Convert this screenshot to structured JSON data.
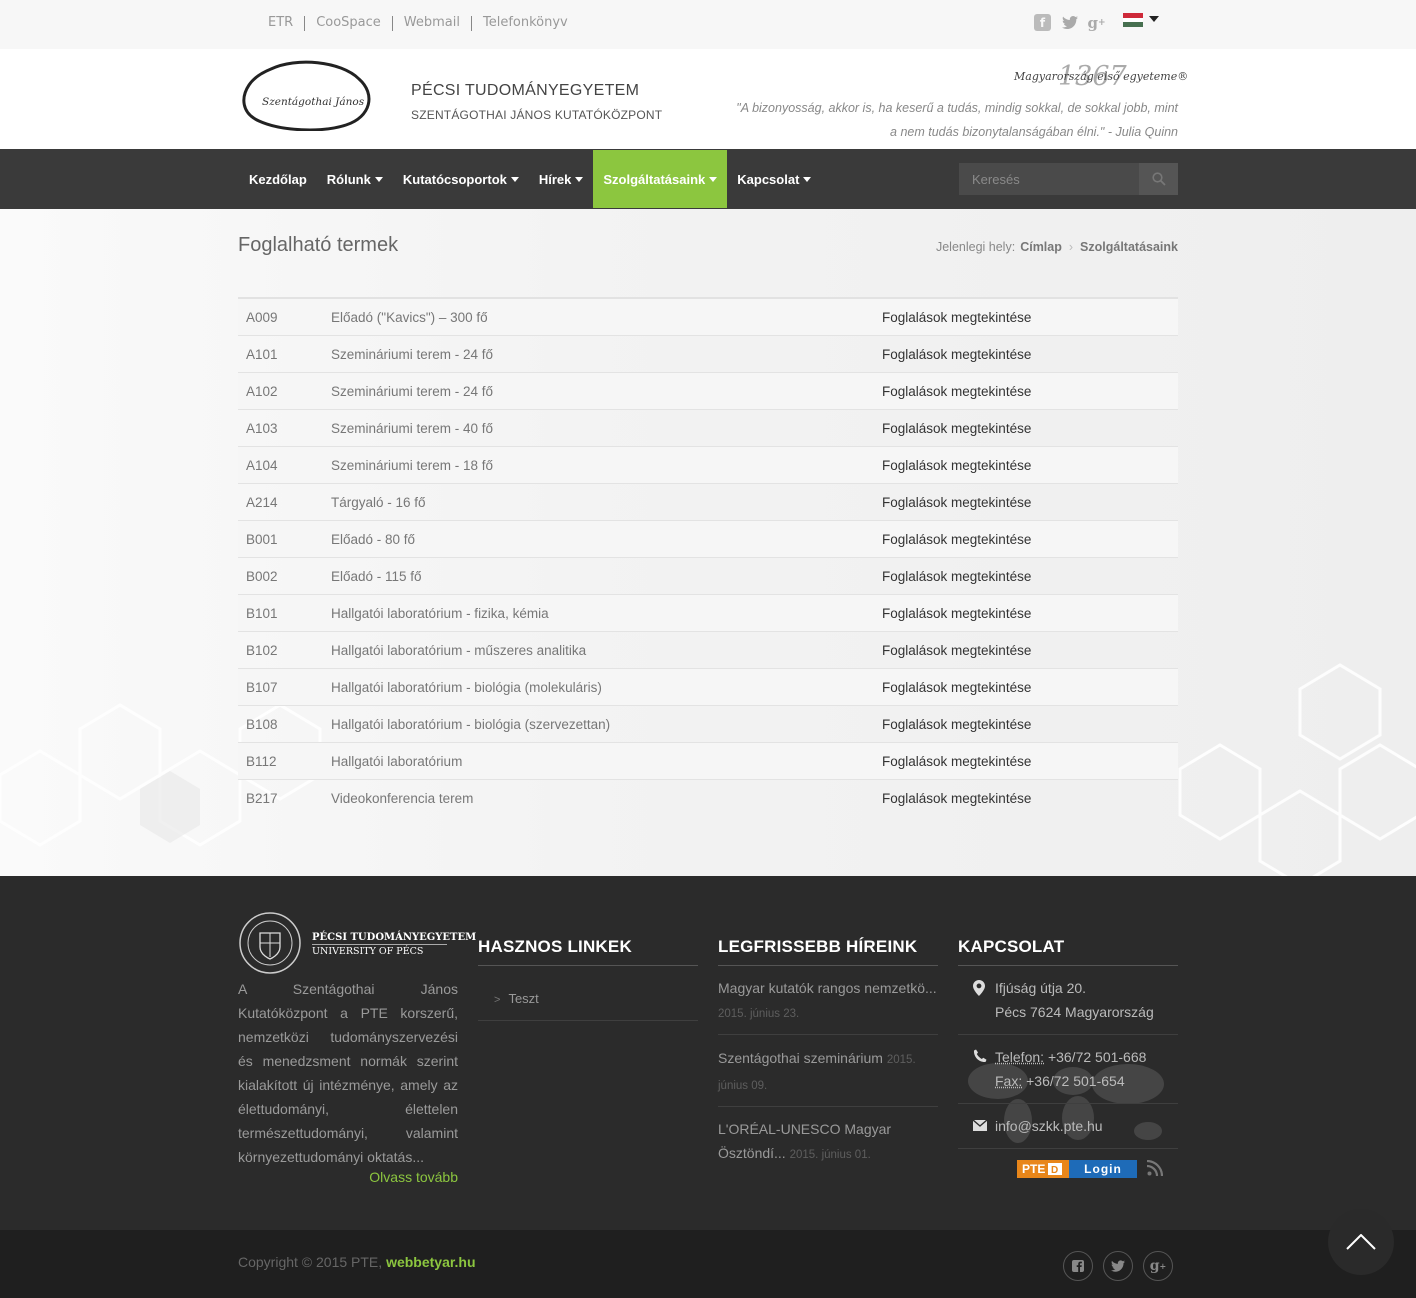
{
  "topbar": {
    "links": [
      "ETR",
      "CooSpace",
      "Webmail",
      "Telefonkönyv"
    ]
  },
  "header": {
    "logo_text": "Szentágothai János",
    "institution": "PÉCSI TUDOMÁNYEGYETEM",
    "subtitle": "SZENTÁGOTHAI JÁNOS KUTATÓKÖZPONT",
    "motto_year": "1367",
    "motto_text": "Magyarország első egyeteme®",
    "quote_line1": "\"A bizonyosság, akkor is, ha keserű a tudás, mindig sokkal, de sokkal jobb, mint",
    "quote_line2": "a nem tudás bizonytalanságában élni.\" - Julia Quinn"
  },
  "nav": {
    "items": [
      "Kezdőlap",
      "Rólunk",
      "Kutatócsoportok",
      "Hírek",
      "Szolgáltatásaink",
      "Kapcsolat"
    ],
    "active_index": 4,
    "search_placeholder": "Keresés"
  },
  "page": {
    "title": "Foglalható termek",
    "breadcrumb_label": "Jelenlegi hely:",
    "breadcrumb": [
      "Címlap",
      "Szolgáltatásaink"
    ]
  },
  "rooms": [
    {
      "code": "A009",
      "name": "Előadó (\"Kavics\") – 300 fő",
      "link": "Foglalások megtekintése"
    },
    {
      "code": "A101",
      "name": "Szemináriumi terem - 24 fő",
      "link": "Foglalások megtekintése"
    },
    {
      "code": "A102",
      "name": "Szemináriumi terem - 24 fő",
      "link": "Foglalások megtekintése"
    },
    {
      "code": "A103",
      "name": "Szemináriumi terem - 40 fő",
      "link": "Foglalások megtekintése"
    },
    {
      "code": "A104",
      "name": "Szemináriumi terem - 18 fő",
      "link": "Foglalások megtekintése"
    },
    {
      "code": "A214",
      "name": "Tárgyaló - 16 fő",
      "link": "Foglalások megtekintése"
    },
    {
      "code": "B001",
      "name": "Előadó - 80 fő",
      "link": "Foglalások megtekintése"
    },
    {
      "code": "B002",
      "name": "Előadó - 115 fő",
      "link": "Foglalások megtekintése"
    },
    {
      "code": "B101",
      "name": "Hallgatói laboratórium - fizika, kémia",
      "link": "Foglalások megtekintése"
    },
    {
      "code": "B102",
      "name": "Hallgatói laboratórium - műszeres analitika",
      "link": "Foglalások megtekintése"
    },
    {
      "code": "B107",
      "name": "Hallgatói laboratórium - biológia (molekuláris)",
      "link": "Foglalások megtekintése"
    },
    {
      "code": "B108",
      "name": "Hallgatói laboratórium - biológia (szervezettan)",
      "link": "Foglalások megtekintése"
    },
    {
      "code": "B112",
      "name": "Hallgatói laboratórium",
      "link": "Foglalások megtekintése"
    },
    {
      "code": "B217",
      "name": "Videokonferencia terem",
      "link": "Foglalások megtekintése"
    }
  ],
  "footer": {
    "pte_logo_line1": "PÉCSI TUDOMÁNYEGYETEM",
    "pte_logo_line2": "UNIVERSITY OF PÉCS",
    "about": "A Szentágothai János Kutatóközpont a PTE korszerű, nemzetközi tudományszervezési és menedzsment normák szerint kialakított új intézménye, amely az élettudományi, élettelen természettudományi, valamint környezettudományi oktatás...",
    "read_more": "Olvass tovább",
    "links_title": "HASZNOS LINKEK",
    "links": [
      "Teszt"
    ],
    "news_title": "LEGFRISSEBB HÍREINK",
    "news": [
      {
        "title": "Magyar kutatók rangos nemzetkö...",
        "date": "2015. június 23."
      },
      {
        "title": "Szentágothai szeminárium",
        "date": "2015. június 09."
      },
      {
        "title": "L'ORÉAL-UNESCO Magyar Ösztöndí...",
        "date": "2015. június 01."
      }
    ],
    "contact_title": "KAPCSOLAT",
    "address_line1": "Ifjúság útja 20.",
    "address_line2": "Pécs 7624 Magyarország",
    "phone_label": "Telefon:",
    "phone": "+36/72 501-668",
    "fax_label": "Fax:",
    "fax": "+36/72 501-654",
    "email": "info@szkk.pte.hu",
    "login_pte": "PTE",
    "login_label": "Login"
  },
  "bottom": {
    "copyright": "Copyright © 2015 PTE,",
    "brand": "webbetyar.hu"
  },
  "colors": {
    "accent": "#8cc63f",
    "nav_bg": "#3a3a3a",
    "footer_bg": "#2b2b2b"
  }
}
